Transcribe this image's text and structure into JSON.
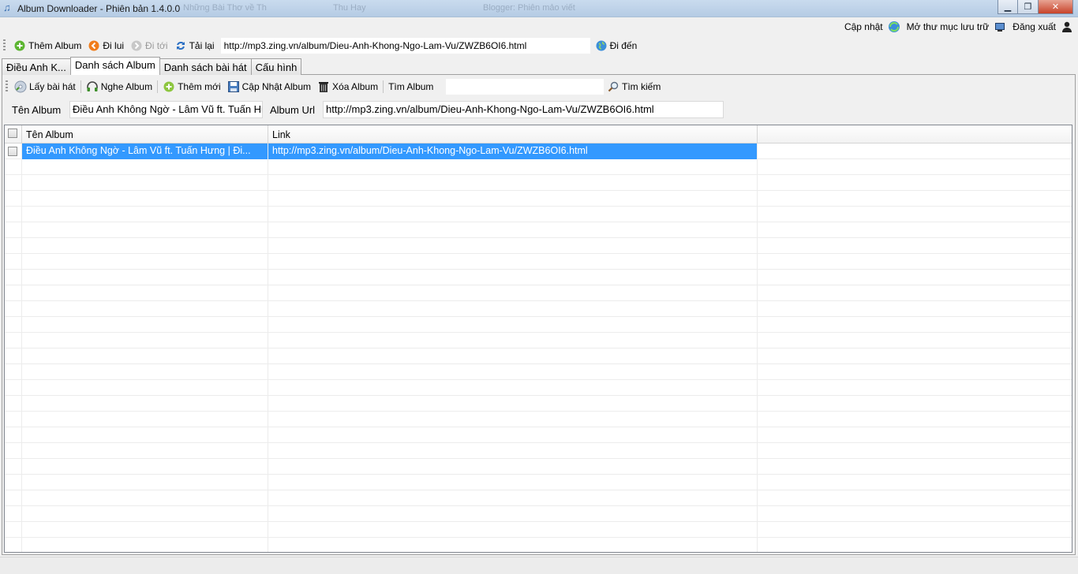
{
  "window": {
    "title": "Album Downloader - Phiên bản 1.4.0.0",
    "background_tabs": [
      "Những Bài Thơ về Th",
      "Thu Hay",
      "Blogger: Phiên mảo viết"
    ],
    "controls": {
      "minimize": "▁",
      "maximize": "❐",
      "close": "✕"
    }
  },
  "top_menu": {
    "update_label": "Cập nhật",
    "open_folder_label": "Mở thư mục lưu trữ",
    "logout_label": "Đăng xuất"
  },
  "nav_toolbar": {
    "add_album": "Thêm Album",
    "back": "Đi lui",
    "forward": "Đi tới",
    "reload": "Tải lại",
    "url": "http://mp3.zing.vn/album/Dieu-Anh-Khong-Ngo-Lam-Vu/ZWZB6OI6.html",
    "go": "Đi đến"
  },
  "tabs": [
    {
      "label": "Điều Anh K...",
      "active": false
    },
    {
      "label": "Danh sách Album",
      "active": true
    },
    {
      "label": "Danh sách bài hát",
      "active": false
    },
    {
      "label": "Cấu hình",
      "active": false
    }
  ],
  "sub_toolbar": {
    "get_songs": "Lấy bài hát",
    "listen_album": "Nghe Album",
    "add_new": "Thêm mới",
    "update_album": "Cập Nhật Album",
    "delete_album": "Xóa Album",
    "find_album": "Tìm Album",
    "search": "Tìm kiếm"
  },
  "filter": {
    "album_name_label": "Tên Album",
    "album_name_value": "Điều Anh Không Ngờ - Lâm Vũ ft. Tuấn Hư",
    "album_url_label": "Album Url",
    "album_url_value": "http://mp3.zing.vn/album/Dieu-Anh-Khong-Ngo-Lam-Vu/ZWZB6OI6.html"
  },
  "grid": {
    "columns": [
      "Tên Album",
      "Link"
    ],
    "rows": [
      {
        "checked": false,
        "selected": true,
        "name": "Điều Anh Không Ngờ - Lâm Vũ ft. Tuấn Hưng | Đi...",
        "link": "http://mp3.zing.vn/album/Dieu-Anh-Khong-Ngo-Lam-Vu/ZWZB6OI6.html"
      }
    ],
    "empty_row_count": 25
  },
  "icons": {
    "app": "music-note-icon",
    "update": "globe-refresh-icon",
    "open_folder": "folder-monitor-icon",
    "logout": "user-icon",
    "add_album": "green-plus-icon",
    "back": "orange-back-icon",
    "forward": "gray-forward-icon",
    "reload": "refresh-icon",
    "go": "globe-icon",
    "get_songs": "cd-icon",
    "listen_album": "headphones-icon",
    "add_new": "green-plus-icon",
    "update_album": "save-icon",
    "delete_album": "trash-icon",
    "search": "magnifier-icon"
  },
  "colors": {
    "selection": "#3399ff",
    "title_bar": "#c9dbee",
    "close_button": "#c7432a",
    "green_icon": "#5cb531",
    "orange_icon": "#f07c1a"
  }
}
